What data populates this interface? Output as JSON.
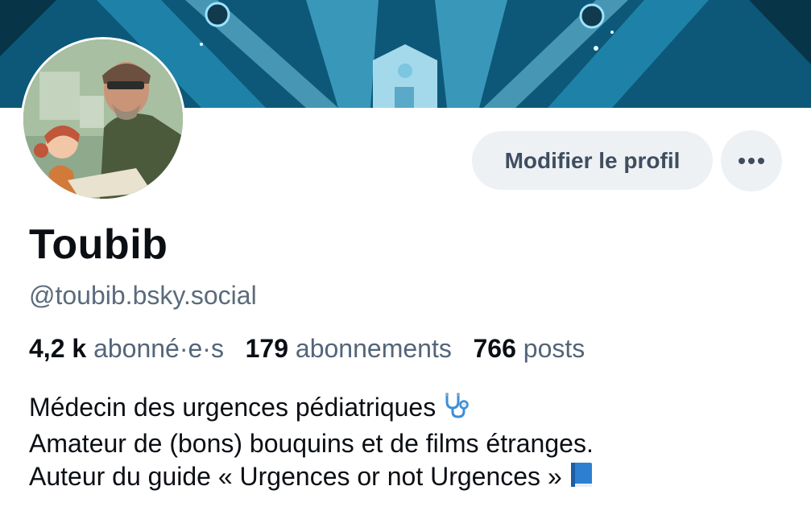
{
  "banner": {
    "accent": "#1a93bd"
  },
  "profile": {
    "display_name": "Toubib",
    "handle": "@toubib.bsky.social",
    "avatar_icon": "avatar-illustration"
  },
  "actions": {
    "edit_label": "Modifier le profil",
    "more_icon": "more-dots-icon"
  },
  "stats": {
    "followers_count": "4,2 k",
    "followers_label": "abonné·e·s",
    "following_count": "179",
    "following_label": "abonnements",
    "posts_count": "766",
    "posts_label": "posts"
  },
  "bio": {
    "line1": "Médecin des urgences pédiatriques",
    "line1_icon": "stethoscope-icon",
    "line2": "Amateur de (bons) bouquins et de films étranges.",
    "line3": "Auteur du guide « Urgences or not Urgences »",
    "line3_icon": "blue-book-icon"
  },
  "colors": {
    "button_bg": "#eef1f4",
    "muted_text": "#53657a",
    "text": "#0b0f14"
  }
}
